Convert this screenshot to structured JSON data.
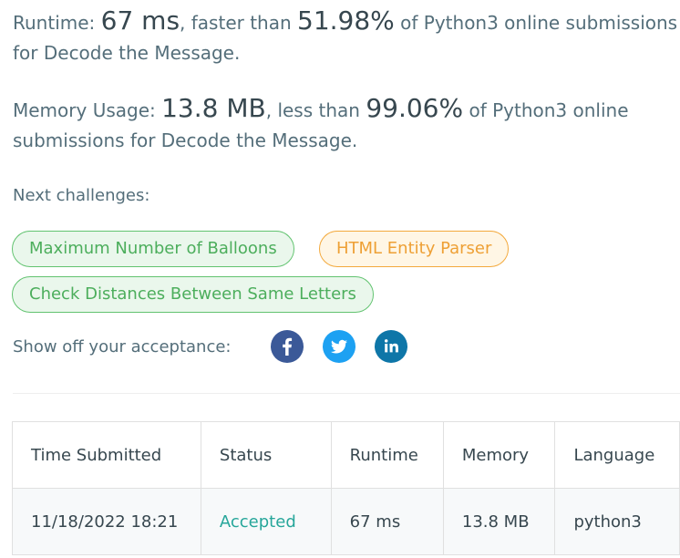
{
  "runtime": {
    "label": "Runtime:",
    "value": "67 ms",
    "comparison": ", faster than",
    "percent": "51.98%",
    "suffix": "of Python3 online submissions for Decode the Message."
  },
  "memory": {
    "label": "Memory Usage:",
    "value": "13.8 MB",
    "comparison": ", less than",
    "percent": "99.06%",
    "suffix": "of Python3 online submissions for Decode the Message."
  },
  "next_challenges": {
    "label": "Next challenges:",
    "items": [
      {
        "title": "Maximum Number of Balloons",
        "difficulty": "easy"
      },
      {
        "title": "HTML Entity Parser",
        "difficulty": "medium"
      },
      {
        "title": "Check Distances Between Same Letters",
        "difficulty": "easy"
      }
    ]
  },
  "share": {
    "label": "Show off your acceptance:",
    "icons": [
      "facebook-icon",
      "twitter-icon",
      "linkedin-icon"
    ]
  },
  "colors": {
    "facebook": "#3b5998",
    "twitter": "#1da1f2",
    "linkedin": "#0e76a8",
    "easy": "#4cae5c",
    "medium": "#eea035",
    "accepted": "#26a69a"
  },
  "submissions": {
    "headers": [
      "Time Submitted",
      "Status",
      "Runtime",
      "Memory",
      "Language"
    ],
    "rows": [
      {
        "time": "11/18/2022 18:21",
        "status": "Accepted",
        "runtime": "67 ms",
        "memory": "13.8 MB",
        "language": "python3"
      }
    ]
  }
}
